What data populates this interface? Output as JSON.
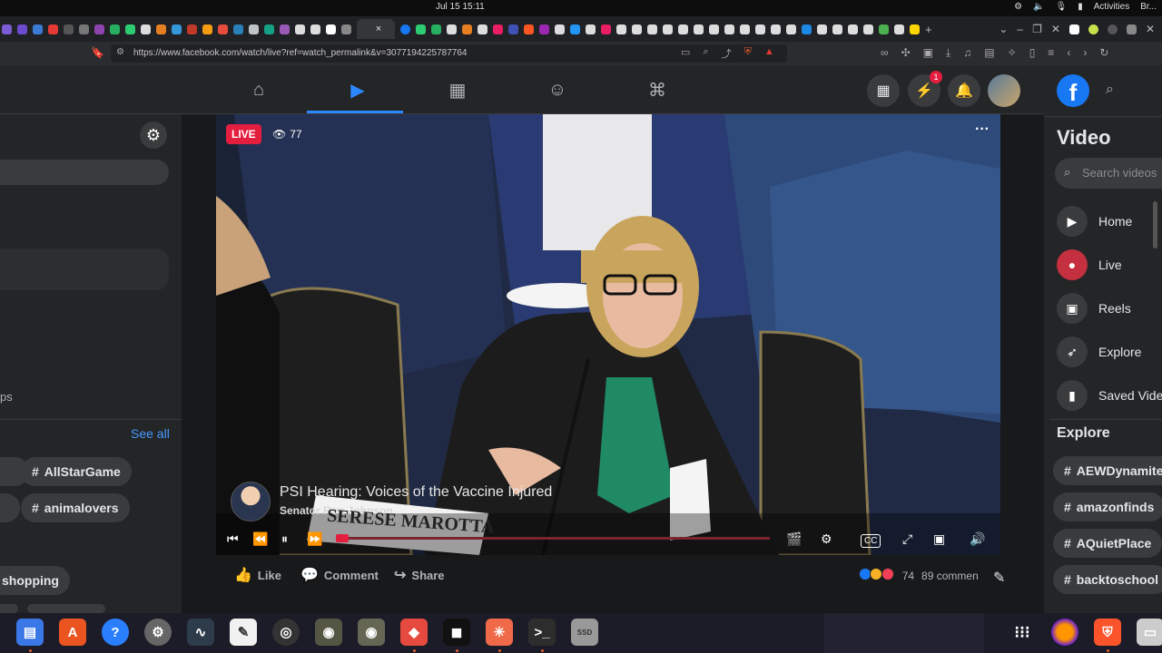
{
  "system": {
    "clock": "Jul 15  15:11",
    "activities": "Activities",
    "browser_label": "Br..."
  },
  "browser": {
    "url": "https://www.facebook.com/watch/live?ref=watch_permalink&v=3077194225787764",
    "active_tab_icon": "x-close-icon",
    "new_tab": "+"
  },
  "facebook": {
    "nav": [
      "home-icon",
      "watch-icon",
      "marketplace-icon",
      "groups-icon",
      "gaming-icon"
    ],
    "messenger_badge": "1",
    "left_panel": {
      "partial_text": "ps",
      "see_all": "See all",
      "hashtags": [
        "AllStarGame",
        "animalovers",
        "shopping"
      ]
    },
    "video": {
      "live_label": "LIVE",
      "viewer_count": "77",
      "title": "PSI Hearing: Voices of the Vaccine Injured",
      "channel": "Senator Ron Johnson",
      "nameplate": "SERESE MAROTTA",
      "progress_fraction": 0.03
    },
    "actions": {
      "like": "Like",
      "comment": "Comment",
      "share": "Share",
      "reaction_count": "74",
      "comments": "89 commen"
    }
  },
  "right_panel": {
    "title": "Video",
    "search_placeholder": "Search videos",
    "items": [
      {
        "label": "Home",
        "icon": "play-icon"
      },
      {
        "label": "Live",
        "icon": "live-camera-icon"
      },
      {
        "label": "Reels",
        "icon": "reels-icon"
      },
      {
        "label": "Explore",
        "icon": "rocket-icon"
      },
      {
        "label": "Saved Vide",
        "icon": "bookmark-icon"
      }
    ],
    "explore_heading": "Explore",
    "hashtags": [
      "AEWDynamite",
      "amazonfinds",
      "AQuietPlace",
      "backtoschool"
    ]
  },
  "dock": {
    "items": [
      "text-editor-icon",
      "app-store-icon",
      "help-icon",
      "settings-icon",
      "system-monitor-icon",
      "notes-icon",
      "obs-icon",
      "gimp-icon",
      "gimp-2-icon",
      "git-icon",
      "box-icon",
      "spark-icon",
      "terminal-icon",
      "ssd-icon",
      "app-grid-icon",
      "firefox-icon",
      "brave-icon",
      "files-icon"
    ],
    "ssd_label": "SSD"
  },
  "colors": {
    "fb_blue": "#1877f2",
    "live_red": "#e41e3f",
    "bg": "#18191a",
    "panel": "#242526"
  }
}
